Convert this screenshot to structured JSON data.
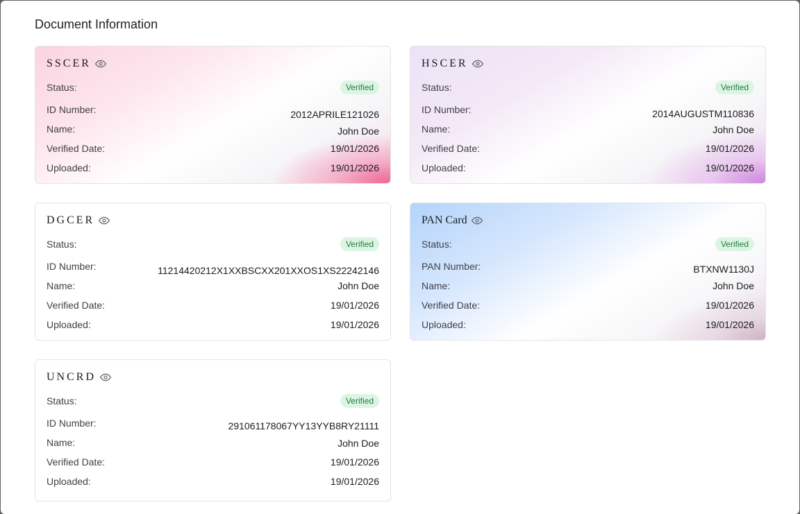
{
  "section_title": "Document Information",
  "labels": {
    "status": "Status:",
    "id_number": "ID Number:",
    "pan_number": "PAN Number:",
    "name": "Name:",
    "verified_date": "Verified Date:",
    "uploaded": "Uploaded:"
  },
  "documents": [
    {
      "title": "SSCER",
      "status": "Verified",
      "id": "2012APRILE121026",
      "name": "John Doe",
      "verified_date": "19/01/2026",
      "uploaded": "19/01/2026"
    },
    {
      "title": "HSCER",
      "status": "Verified",
      "id": "2014AUGUSTM110836",
      "name": "John Doe",
      "verified_date": "19/01/2026",
      "uploaded": "19/01/2026"
    },
    {
      "title": "DGCER",
      "status": "Verified",
      "id": "11214420212X1XXBSCXX201XXOS1XS22242146",
      "name": "John Doe",
      "verified_date": "19/01/2026",
      "uploaded": "19/01/2026"
    },
    {
      "title": "PAN Card",
      "status": "Verified",
      "id": "BTXNW1130J",
      "name": "John Doe",
      "verified_date": "19/01/2026",
      "uploaded": "19/01/2026"
    },
    {
      "title": "UNCRD",
      "status": "Verified",
      "id": "291061178067YY13YYB8RY21111",
      "name": "John Doe",
      "verified_date": "19/01/2026",
      "uploaded": "19/01/2026"
    }
  ],
  "icons": {
    "view": "eye-icon"
  },
  "colors": {
    "badge_bg": "#dcf5e3",
    "badge_text": "#1f7a3f"
  }
}
